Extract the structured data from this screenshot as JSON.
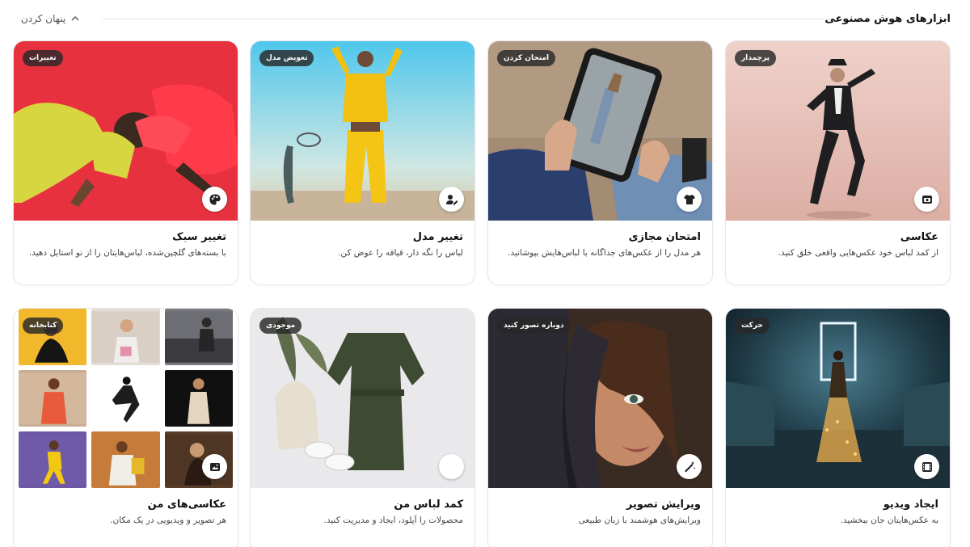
{
  "header": {
    "title": "ابزارهای هوش مصنوعی",
    "hide_label": "پنهان کردن"
  },
  "cards": [
    {
      "title": "عکاسی",
      "description": "از کمد لباس خود عکس‌هایی واقعی خلق کنید.",
      "badge": "پرچمدار",
      "icon": "camera-icon"
    },
    {
      "title": "امتحان مجازی",
      "description": "هر مدل را از عکس‌های جداگانه با لباس‌هایش بپوشانید.",
      "badge": "امتحان کردن",
      "icon": "tshirt-icon"
    },
    {
      "title": "تغییر مدل",
      "description": "لباس را نگه دار، قیافه را عوض کن.",
      "badge": "تعویض مدل",
      "icon": "person-edit-icon"
    },
    {
      "title": "تغییر سبک",
      "description": "با بسته‌های گلچین‌شده، لباس‌هایتان را از نو استایل دهید.",
      "badge": "تغییرات",
      "icon": "palette-icon"
    },
    {
      "title": "ایجاد ویدیو",
      "description": "به عکس‌هایتان جان ببخشید.",
      "badge": "حرکت",
      "icon": "film-icon"
    },
    {
      "title": "ویرایش تصویر",
      "description": "ویرایش‌های هوشمند با زبان طبیعی",
      "badge": "دوباره تصور کنید",
      "icon": "magic-wand-icon"
    },
    {
      "title": "کمد لباس من",
      "description": "محصولات را آپلود، ایجاد و مدیریت کنید.",
      "badge": "موجودی",
      "icon": "blank-circle-icon"
    },
    {
      "title": "عکاسی‌های من",
      "description": "هر تصویر و ویدیویی در یک مکان.",
      "badge": "کتابخانه",
      "icon": "image-icon"
    }
  ]
}
